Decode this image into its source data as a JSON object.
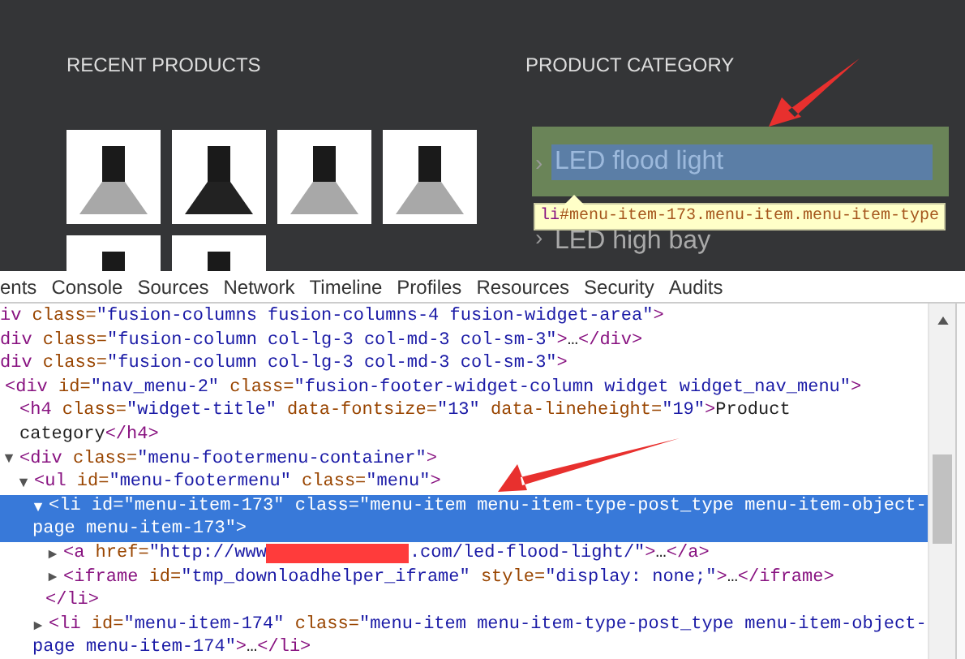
{
  "footer": {
    "recent_products": {
      "title": "RECENT PRODUCTS"
    },
    "product_category": {
      "title": "PRODUCT CATEGORY",
      "items": [
        {
          "chevron": "›",
          "label": "LED flood light",
          "inspected": true
        },
        {
          "chevron": "›",
          "label": "LED high bay",
          "inspected": false
        }
      ],
      "tooltip": {
        "tag": "li",
        "selector": "#menu-item-173.menu-item.menu-item-type"
      }
    }
  },
  "devtools": {
    "tabs": [
      {
        "label": "ents"
      },
      {
        "label": "Console"
      },
      {
        "label": "Sources"
      },
      {
        "label": "Network"
      },
      {
        "label": "Timeline"
      },
      {
        "label": "Profiles"
      },
      {
        "label": "Resources"
      },
      {
        "label": "Security"
      },
      {
        "label": "Audits"
      }
    ],
    "tree": [
      {
        "selected": false,
        "lines": [
          [
            {
              "kind": "tag",
              "text": "iv"
            },
            {
              "kind": "attr",
              "text": " class="
            },
            {
              "kind": "value",
              "text": "\"fusion-columns fusion-columns-4 fusion-widget-area\""
            },
            {
              "kind": "tag",
              "text": ">"
            }
          ]
        ],
        "children": [
          {
            "selected": false,
            "lines": [
              [
                {
                  "kind": "tag",
                  "text": "div"
                },
                {
                  "kind": "attr",
                  "text": " class="
                },
                {
                  "kind": "value",
                  "text": "\"fusion-column col-lg-3 col-md-3 col-sm-3\""
                },
                {
                  "kind": "tag",
                  "text": ">"
                },
                {
                  "kind": "text",
                  "text": "…"
                },
                {
                  "kind": "tag",
                  "text": "</div>"
                }
              ]
            ]
          },
          {
            "selected": false,
            "lines": [
              [
                {
                  "kind": "tag",
                  "text": "div"
                },
                {
                  "kind": "attr",
                  "text": " class="
                },
                {
                  "kind": "value",
                  "text": "\"fusion-column col-lg-3 col-md-3 col-sm-3\""
                },
                {
                  "kind": "tag",
                  "text": ">"
                }
              ]
            ],
            "children": [
              {
                "selected": false,
                "lines": [
                  [
                    {
                      "kind": "tag",
                      "text": "<div"
                    },
                    {
                      "kind": "attr",
                      "text": " id="
                    },
                    {
                      "kind": "value",
                      "text": "\"nav_menu-2\""
                    },
                    {
                      "kind": "attr",
                      "text": " class="
                    },
                    {
                      "kind": "value",
                      "text": "\"fusion-footer-widget-column widget widget_nav_menu\""
                    },
                    {
                      "kind": "tag",
                      "text": ">"
                    }
                  ]
                ],
                "children": [
                  {
                    "selected": false,
                    "lines": [
                      [
                        {
                          "kind": "tag",
                          "text": "<h4"
                        },
                        {
                          "kind": "attr",
                          "text": " class="
                        },
                        {
                          "kind": "value",
                          "text": "\"widget-title\""
                        },
                        {
                          "kind": "attr",
                          "text": " data-fontsize="
                        },
                        {
                          "kind": "value",
                          "text": "\"13\""
                        },
                        {
                          "kind": "attr",
                          "text": " data-lineheight="
                        },
                        {
                          "kind": "value",
                          "text": "\"19\""
                        },
                        {
                          "kind": "tag",
                          "text": ">"
                        },
                        {
                          "kind": "text",
                          "text": "Product"
                        }
                      ],
                      [
                        {
                          "kind": "text",
                          "text": "category"
                        },
                        {
                          "kind": "tag",
                          "text": "</h4>"
                        }
                      ]
                    ]
                  },
                  {
                    "selected": false,
                    "expanded": true,
                    "lines": [
                      [
                        {
                          "kind": "tag",
                          "text": "<div"
                        },
                        {
                          "kind": "attr",
                          "text": " class="
                        },
                        {
                          "kind": "value",
                          "text": "\"menu-footermenu-container\""
                        },
                        {
                          "kind": "tag",
                          "text": ">"
                        }
                      ]
                    ],
                    "children": [
                      {
                        "selected": false,
                        "expanded": true,
                        "lines": [
                          [
                            {
                              "kind": "tag",
                              "text": "<ul"
                            },
                            {
                              "kind": "attr",
                              "text": " id="
                            },
                            {
                              "kind": "value",
                              "text": "\"menu-footermenu\""
                            },
                            {
                              "kind": "attr",
                              "text": " class="
                            },
                            {
                              "kind": "value",
                              "text": "\"menu\""
                            },
                            {
                              "kind": "tag",
                              "text": ">"
                            }
                          ]
                        ],
                        "children": [
                          {
                            "selected": true,
                            "expanded": true,
                            "lines": [
                              [
                                {
                                  "kind": "tag",
                                  "text": "<li"
                                },
                                {
                                  "kind": "attr",
                                  "text": " id="
                                },
                                {
                                  "kind": "value",
                                  "text": "\"menu-item-173\""
                                },
                                {
                                  "kind": "attr",
                                  "text": " class="
                                },
                                {
                                  "kind": "value",
                                  "text": "\"menu-item menu-item-type-post_type menu-item-object-"
                                }
                              ],
                              [
                                {
                                  "kind": "value",
                                  "text": "page menu-item-173\""
                                },
                                {
                                  "kind": "tag",
                                  "text": ">"
                                }
                              ]
                            ],
                            "closing": [
                              {
                                "kind": "tag",
                                "text": "</li>"
                              }
                            ],
                            "children": [
                              {
                                "selected": false,
                                "expanded": false,
                                "lines": [
                                  [
                                    {
                                      "kind": "tag",
                                      "text": "<a"
                                    },
                                    {
                                      "kind": "attr",
                                      "text": " href="
                                    },
                                    {
                                      "kind": "value",
                                      "text": "\"http://www"
                                    },
                                    {
                                      "kind": "redacted"
                                    },
                                    {
                                      "kind": "value",
                                      "text": ".com/led-flood-light/\""
                                    },
                                    {
                                      "kind": "tag",
                                      "text": ">"
                                    },
                                    {
                                      "kind": "text",
                                      "text": "…"
                                    },
                                    {
                                      "kind": "tag",
                                      "text": "</a>"
                                    }
                                  ]
                                ]
                              },
                              {
                                "selected": false,
                                "expanded": false,
                                "lines": [
                                  [
                                    {
                                      "kind": "tag",
                                      "text": "<iframe"
                                    },
                                    {
                                      "kind": "attr",
                                      "text": " id="
                                    },
                                    {
                                      "kind": "value",
                                      "text": "\"tmp_downloadhelper_iframe\""
                                    },
                                    {
                                      "kind": "attr",
                                      "text": " style="
                                    },
                                    {
                                      "kind": "value",
                                      "text": "\"display: none;\""
                                    },
                                    {
                                      "kind": "tag",
                                      "text": ">"
                                    },
                                    {
                                      "kind": "text",
                                      "text": "…"
                                    },
                                    {
                                      "kind": "tag",
                                      "text": "</iframe>"
                                    }
                                  ]
                                ]
                              }
                            ]
                          },
                          {
                            "selected": false,
                            "expanded": false,
                            "lines": [
                              [
                                {
                                  "kind": "tag",
                                  "text": "<li"
                                },
                                {
                                  "kind": "attr",
                                  "text": " id="
                                },
                                {
                                  "kind": "value",
                                  "text": "\"menu-item-174\""
                                },
                                {
                                  "kind": "attr",
                                  "text": " class="
                                },
                                {
                                  "kind": "value",
                                  "text": "\"menu-item menu-item-type-post_type menu-item-object-"
                                }
                              ],
                              [
                                {
                                  "kind": "value",
                                  "text": "page menu-item-174\""
                                },
                                {
                                  "kind": "tag",
                                  "text": ">"
                                },
                                {
                                  "kind": "text",
                                  "text": "…"
                                },
                                {
                                  "kind": "tag",
                                  "text": "</li>"
                                }
                              ]
                            ]
                          }
                        ]
                      }
                    ]
                  }
                ]
              }
            ]
          }
        ]
      }
    ]
  }
}
